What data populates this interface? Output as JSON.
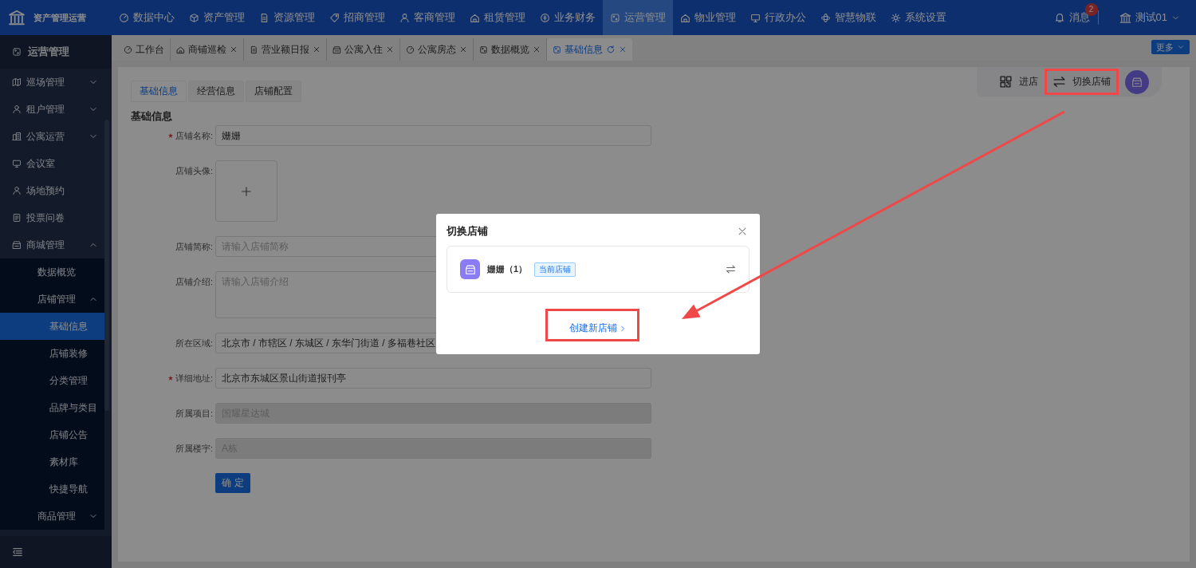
{
  "app": {
    "title": "资产管理运营"
  },
  "top_nav": [
    {
      "label": "数据中心",
      "selected": false
    },
    {
      "label": "资产管理",
      "selected": false
    },
    {
      "label": "资源管理",
      "selected": false
    },
    {
      "label": "招商管理",
      "selected": false
    },
    {
      "label": "客商管理",
      "selected": false
    },
    {
      "label": "租赁管理",
      "selected": false
    },
    {
      "label": "业务财务",
      "selected": false
    },
    {
      "label": "运营管理",
      "selected": true
    },
    {
      "label": "物业管理",
      "selected": false
    },
    {
      "label": "行政办公",
      "selected": false
    },
    {
      "label": "智慧物联",
      "selected": false
    },
    {
      "label": "系统设置",
      "selected": false
    }
  ],
  "header_right": {
    "messages": {
      "label": "消息",
      "badge": "2"
    },
    "user": {
      "name": "测试01"
    }
  },
  "sidebar": {
    "title": "运营管理",
    "items": [
      {
        "label": "巡场管理",
        "kind": "group",
        "expanded": false,
        "selected": false
      },
      {
        "label": "租户管理",
        "kind": "group",
        "expanded": false,
        "selected": false
      },
      {
        "label": "公寓运营",
        "kind": "group",
        "expanded": false,
        "selected": false
      },
      {
        "label": "会议室",
        "kind": "item",
        "selected": false
      },
      {
        "label": "场地预约",
        "kind": "item",
        "selected": false
      },
      {
        "label": "投票问卷",
        "kind": "item",
        "selected": false
      },
      {
        "label": "商城管理",
        "kind": "group",
        "expanded": true,
        "selected": false,
        "children": [
          {
            "label": "数据概览",
            "kind": "item",
            "selected": false
          },
          {
            "label": "店铺管理",
            "kind": "group",
            "expanded": true,
            "selected": false,
            "children": [
              {
                "label": "基础信息",
                "kind": "item",
                "selected": true
              },
              {
                "label": "店铺装修",
                "kind": "item",
                "selected": false
              },
              {
                "label": "分类管理",
                "kind": "item",
                "selected": false
              },
              {
                "label": "品牌与类目",
                "kind": "item",
                "selected": false
              },
              {
                "label": "店铺公告",
                "kind": "item",
                "selected": false
              },
              {
                "label": "素材库",
                "kind": "item",
                "selected": false
              },
              {
                "label": "快捷导航",
                "kind": "item",
                "selected": false
              }
            ]
          },
          {
            "label": "商品管理",
            "kind": "group",
            "expanded": false,
            "selected": false
          }
        ]
      }
    ]
  },
  "open_tabs": [
    {
      "label": "工作台",
      "selected": false,
      "closable": false
    },
    {
      "label": "商铺巡检",
      "selected": false,
      "closable": true
    },
    {
      "label": "营业额日报",
      "selected": false,
      "closable": true
    },
    {
      "label": "公寓入住",
      "selected": false,
      "closable": true
    },
    {
      "label": "公寓房态",
      "selected": false,
      "closable": true
    },
    {
      "label": "数据概览",
      "selected": false,
      "closable": true
    },
    {
      "label": "基础信息",
      "selected": true,
      "closable": true
    }
  ],
  "more_button": "更多",
  "form_tabs": [
    {
      "label": "基础信息",
      "selected": true
    },
    {
      "label": "经营信息",
      "selected": false
    },
    {
      "label": "店铺配置",
      "selected": false
    }
  ],
  "section_title": "基础信息",
  "form": {
    "fields": [
      {
        "kind": "input",
        "label": "店铺名称:",
        "required": true,
        "disabled": false,
        "value": "姗姗"
      },
      {
        "kind": "upload",
        "label": "店铺头像:",
        "required": false
      },
      {
        "kind": "input",
        "label": "店铺简称:",
        "required": false,
        "disabled": false,
        "placeholder": "请输入店铺简称"
      },
      {
        "kind": "textarea",
        "label": "店铺介绍:",
        "required": false,
        "disabled": false,
        "placeholder": "请输入店铺介绍"
      },
      {
        "kind": "input",
        "label": "所在区域:",
        "required": false,
        "disabled": false,
        "value": "北京市 / 市辖区 / 东城区 / 东华门街道 / 多福巷社区"
      },
      {
        "kind": "input",
        "label": "详细地址:",
        "required": true,
        "disabled": false,
        "value": "北京市东城区景山街道报刊亭"
      },
      {
        "kind": "input",
        "label": "所属项目:",
        "required": false,
        "disabled": true,
        "placeholder": "国耀星达城"
      },
      {
        "kind": "input",
        "label": "所属楼宇:",
        "required": false,
        "disabled": true,
        "placeholder": "A栋"
      }
    ],
    "submit": "确 定"
  },
  "store_toolbar": {
    "enter": "进店",
    "switch": "切换店铺"
  },
  "dialog": {
    "title": "切换店铺",
    "stores": [
      {
        "name": "姗姗（1）",
        "tag": "当前店铺"
      }
    ],
    "create_link": "创建新店铺"
  }
}
